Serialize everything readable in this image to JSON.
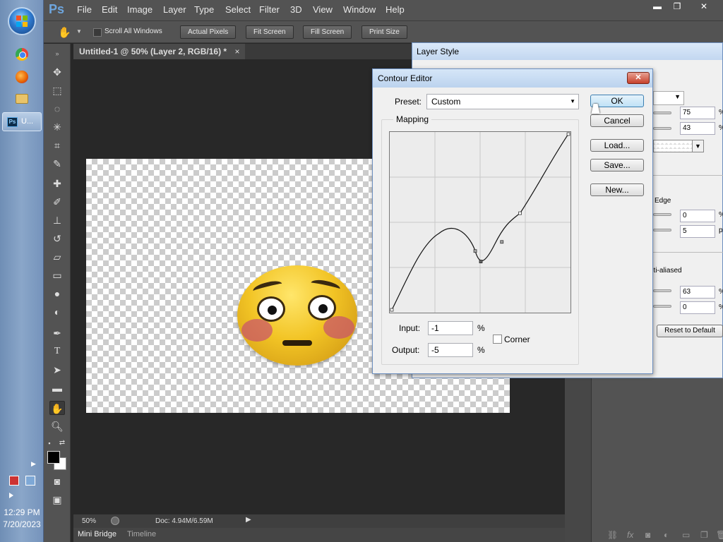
{
  "taskbar": {
    "clock_time": "12:29 PM",
    "clock_date": "7/20/2023",
    "ps_task_label": "U...",
    "ps_task_icon_text": "Ps"
  },
  "app": {
    "logo": "Ps",
    "menus": [
      "File",
      "Edit",
      "Image",
      "Layer",
      "Type",
      "Select",
      "Filter",
      "3D",
      "View",
      "Window",
      "Help"
    ],
    "window_minimize": "▬",
    "window_restore": "❐",
    "window_close": "✕"
  },
  "options_bar": {
    "scroll_all_label": "Scroll All Windows",
    "buttons": [
      "Actual Pixels",
      "Fit Screen",
      "Fill Screen",
      "Print Size"
    ]
  },
  "document": {
    "tab_title": "Untitled-1 @ 50% (Layer 2, RGB/16) *",
    "tab_close": "×",
    "zoom": "50%",
    "doc_size": "Doc: 4.94M/6.59M"
  },
  "bottom_tabs": [
    "Mini Bridge",
    "Timeline"
  ],
  "layer_style": {
    "title": "Layer Style",
    "fields": [
      "75",
      "43",
      "0",
      "5",
      "63",
      "0"
    ],
    "pct_unit": "%",
    "px_unit": "px",
    "edge_label": "Edge",
    "antialiased_label": "nti-aliased",
    "reset_button": "Reset to Default"
  },
  "contour_editor": {
    "title": "Contour Editor",
    "close_label": "✕",
    "preset_label": "Preset:",
    "preset_value": "Custom",
    "mapping_label": "Mapping",
    "input_label": "Input:",
    "input_value": "-1",
    "output_label": "Output:",
    "output_value": "-5",
    "pct_unit": "%",
    "corner_label": "Corner",
    "buttons": {
      "ok": "OK",
      "cancel": "Cancel",
      "load": "Load...",
      "save": "Save...",
      "new": "New..."
    }
  },
  "colors": {
    "ps_chrome": "#535353",
    "canvas_bg": "#282828",
    "dialog_bg": "#f0f0f0",
    "ok_accent": "#3c7fb1"
  }
}
